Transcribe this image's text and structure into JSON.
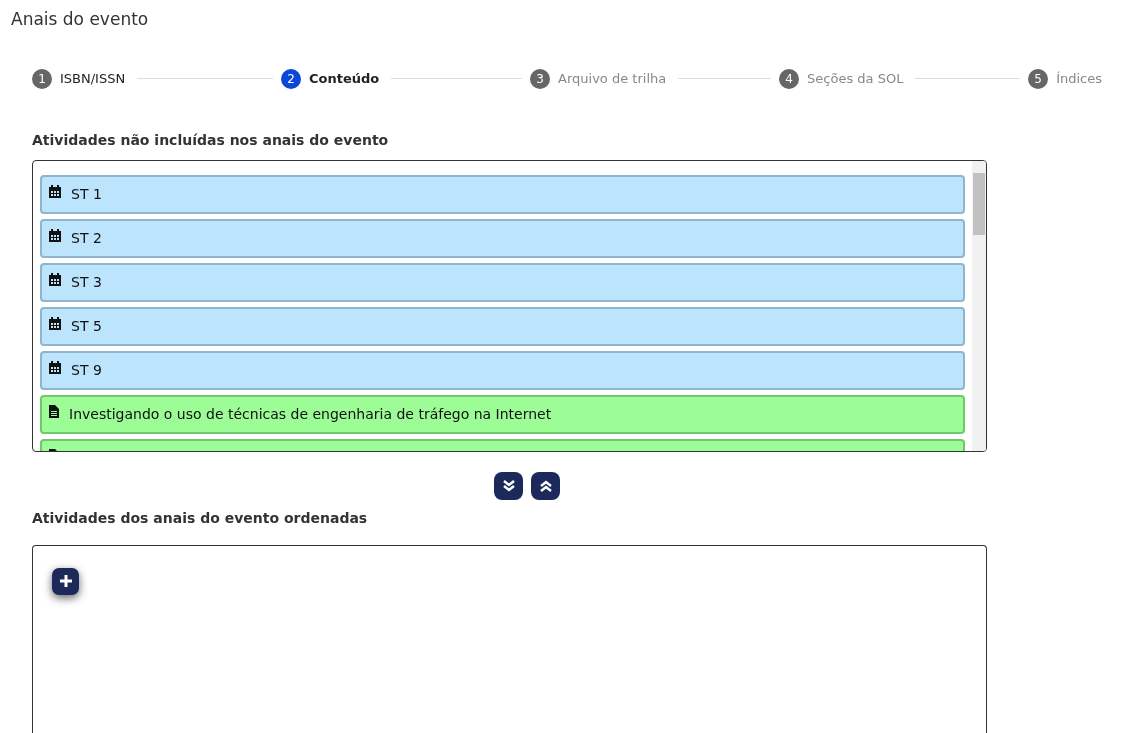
{
  "page_title": "Anais do evento",
  "steps": [
    {
      "number": "1",
      "label": "ISBN/ISSN",
      "selected": false,
      "completed": true
    },
    {
      "number": "2",
      "label": "Conteúdo",
      "selected": true
    },
    {
      "number": "3",
      "label": "Arquivo de trilha",
      "selected": false,
      "completed": false
    },
    {
      "number": "4",
      "label": "Seções da SOL",
      "selected": false,
      "completed": false
    },
    {
      "number": "5",
      "label": "Índices",
      "selected": false,
      "completed": false
    }
  ],
  "excluded": {
    "heading": "Atividades não incluídas nos anais do evento",
    "items": [
      {
        "kind": "session",
        "title": "ST 1"
      },
      {
        "kind": "session",
        "title": "ST 2"
      },
      {
        "kind": "session",
        "title": "ST 3"
      },
      {
        "kind": "session",
        "title": "ST 5"
      },
      {
        "kind": "session",
        "title": "ST 9"
      },
      {
        "kind": "paper",
        "title": "Investigando o uso de técnicas de engenharia de tráfego na Internet"
      },
      {
        "kind": "paper"
      }
    ]
  },
  "move_buttons": [
    {
      "kind": "down"
    },
    {
      "kind": "up"
    }
  ],
  "ordered": {
    "heading": "Atividades dos anais do evento ordenadas"
  }
}
